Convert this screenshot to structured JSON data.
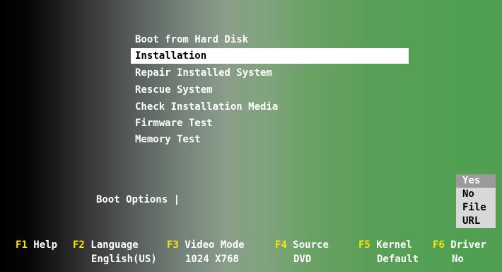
{
  "menu": {
    "items": [
      {
        "label": "Boot from Hard Disk"
      },
      {
        "label": "Installation"
      },
      {
        "label": "Repair Installed System"
      },
      {
        "label": "Rescue System"
      },
      {
        "label": "Check Installation Media"
      },
      {
        "label": "Firmware Test"
      },
      {
        "label": "Memory Test"
      }
    ],
    "selected": "Installation"
  },
  "boot_options": {
    "label": "Boot Options |",
    "value": ""
  },
  "popup": {
    "options": [
      "Yes",
      "No",
      "File",
      "URL"
    ],
    "selected": "Yes"
  },
  "function_keys": [
    {
      "key": "F1",
      "label": "Help"
    },
    {
      "key": "F2",
      "label": "Language",
      "value": "English(US)"
    },
    {
      "key": "F3",
      "label": "Video Mode",
      "value": "1024 X768"
    },
    {
      "key": "F4",
      "label": "Source",
      "value": "DVD"
    },
    {
      "key": "F5",
      "label": "Kernel",
      "value": "Default"
    },
    {
      "key": "F6",
      "label": "Driver",
      "value": "No"
    }
  ],
  "colors": {
    "fkey_highlight": "#f6e600",
    "selection_bg": "#ffffff",
    "background_green": "#4f9f51"
  }
}
